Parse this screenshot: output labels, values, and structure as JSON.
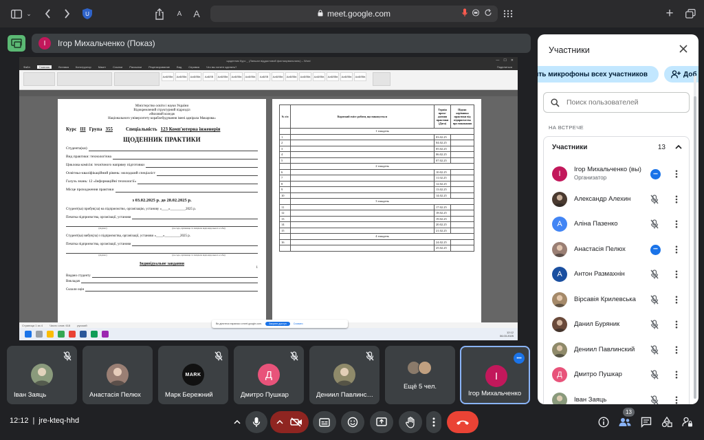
{
  "browser": {
    "url": "meet.google.com",
    "font_small": "A",
    "font_large": "A"
  },
  "presenter": {
    "initial": "І",
    "label": "Ігор Михальченко (Показ)"
  },
  "word": {
    "window_title": "щоденник Курс _ (Ланшал віддастовий фахтаарвальпаль) – Word",
    "tabs": [
      "Файл",
      "Главная",
      "Вставка",
      "Конструктор",
      "Макет",
      "Ссылки",
      "Рассылки",
      "Рецензирование",
      "Вид",
      "Справка",
      "Что вы хотите сделать?"
    ],
    "share": "Поделиться",
    "styles": [
      "АаБбВв",
      "АаБбВв",
      "АаБбВв",
      "АаБбВ",
      "АаБбВв",
      "АаБбВв",
      "АаБбВв",
      "АаБбВ",
      "АаБбВв",
      "АаБбВв",
      "АаБбВв",
      "АаБбВв",
      "АаБбВв",
      "АаБбВв",
      "АаБбВв"
    ],
    "status": [
      "Страница 1 из 4",
      "Число слов: 618",
      "русский"
    ],
    "left_page": {
      "header": [
        "Міністерство освіти і науки України",
        "Відокремлений структурний підрозділ",
        "«Фаховий коледж",
        "Національного університету кораблебудування імені адмірала Макарова»"
      ],
      "kurs_label": "Курс",
      "kurs": "ІІІ",
      "grupa_label": "Група",
      "grupa": "355",
      "spec_label": "Спеціальність",
      "spec": "123 Комп'ютерна інженерія",
      "title": "ЩОДЕННИК ПРАКТИКИ",
      "lines": [
        "Студента(ки)",
        "Вид практики: технологічна",
        "Циклова комісія: технічного напряму підготовки",
        "Освітньо-кваліфікаційний рівень: молодший спеціаліст",
        "Галузь знань: 12 «Інформаційні технології»",
        "Місце проходження практики"
      ],
      "dates": "з 03.02.2025 р. до 28.02.2025 р.",
      "arrived": "Студент(ка) прибув(ла) на підприємство, організацію, установу  «____»_________2025 р.",
      "stamp": "Печатка підприємства, організації, установи",
      "hint_sign": "(підпис)",
      "hint_full": "(посада, прізвище та ініціали відповідальної особи)",
      "left": "Студент(ка) вибув(ла) з підприємства, організації, установи  «____»_________2025 р.",
      "stamp2": "Печатка підприємства, організації, установи",
      "individual": "Індивідуальне завдання",
      "issued": "Видано студенту",
      "teacher": "Викладач",
      "exam": "Склали оцін",
      "page_num": "1"
    },
    "table": {
      "headers": [
        "№ з/п",
        "Короткий зміст роботи, що виконується",
        "Термін прохо-дження практики (Дата)",
        "Підпис керівника практики від підприємства про виконання"
      ],
      "weeks": [
        "1 тиждень",
        "2 тиждень",
        "3 тиждень",
        "4 тиждень"
      ],
      "rows": [
        {
          "n": "1",
          "d": "03.02.25"
        },
        {
          "n": "2",
          "d": "04.02.25"
        },
        {
          "n": "3",
          "d": "05.02.25"
        },
        {
          "n": "4",
          "d": "06.02.25"
        },
        {
          "n": "5",
          "d": "07.02.25"
        },
        {
          "n": "6",
          "d": "10.02.25"
        },
        {
          "n": "7",
          "d": "11.02.25"
        },
        {
          "n": "8",
          "d": "12.02.25"
        },
        {
          "n": "9",
          "d": "13.02.25"
        },
        {
          "n": "10",
          "d": "14.02.25"
        },
        {
          "n": "11",
          "d": "17.02.25"
        },
        {
          "n": "12",
          "d": "18.02.25"
        },
        {
          "n": "13",
          "d": "19.02.25"
        },
        {
          "n": "14",
          "d": "20.02.25"
        },
        {
          "n": "15",
          "d": "21.02.25"
        },
        {
          "n": "16",
          "d": "24.02.25"
        },
        {
          "n": "",
          "d": "25.02.25"
        }
      ]
    },
    "share_notice": {
      "text": "Ви ділитеся екраном з meet.google.com.",
      "stop": "Закрити доступ",
      "hide": "Сховати"
    },
    "taskbar_time": "12:12",
    "taskbar_date": "06.03.2025"
  },
  "tiles": [
    {
      "name": "Іван Заяць",
      "muted": true,
      "kind": "photo",
      "color": "#8a9a7c"
    },
    {
      "name": "Анастасія Пелюх",
      "muted": false,
      "kind": "photo",
      "color": "#9a7f74"
    },
    {
      "name": "Марк Бережний",
      "muted": true,
      "kind": "logo",
      "logo": "MARK"
    },
    {
      "name": "Дмитро Пушкар",
      "muted": true,
      "kind": "letter",
      "initial": "Д",
      "color": "#e8537a"
    },
    {
      "name": "Дениил Павлинский",
      "muted": true,
      "kind": "photo",
      "color": "#8f8a6a"
    },
    {
      "name": "Ещё 5 чел.",
      "muted": false,
      "kind": "more"
    },
    {
      "name": "Ігор Михальченко",
      "muted": false,
      "kind": "letter",
      "initial": "І",
      "color": "#c2185b",
      "active": true
    }
  ],
  "bottom": {
    "time": "12:12",
    "separator": "|",
    "code": "jre-kteq-hhd",
    "people_count": "13"
  },
  "panel": {
    "title": "Участники",
    "mute_all": "Отключить микрофоны всех участников",
    "add": "Доб",
    "search_placeholder": "Поиск пользователей",
    "section": "НА ВСТРЕЧЕ",
    "group": "Участники",
    "count": "13",
    "participants": [
      {
        "name": "Ігор Михальченко (вы)",
        "role": "Организатор",
        "status": "dots",
        "initial": "І",
        "color": "#c2185b",
        "kind": "letter"
      },
      {
        "name": "Александр Алехин",
        "role": "",
        "status": "muted",
        "kind": "photo",
        "color": "#4a3a30"
      },
      {
        "name": "Аліна Пазенко",
        "role": "",
        "status": "muted",
        "initial": "А",
        "color": "#4285f4",
        "kind": "letter"
      },
      {
        "name": "Анастасія Пелюх",
        "role": "",
        "status": "dots",
        "kind": "photo",
        "color": "#9a7f74"
      },
      {
        "name": "Антон Размахнін",
        "role": "",
        "status": "muted",
        "initial": "А",
        "color": "#1a4fa0",
        "kind": "letter"
      },
      {
        "name": "Вірсавія Крилевська",
        "role": "",
        "status": "muted",
        "kind": "photo",
        "color": "#a58a6a"
      },
      {
        "name": "Данил Буряник",
        "role": "",
        "status": "muted",
        "kind": "photo",
        "color": "#6a4a3a"
      },
      {
        "name": "Дениил Павлинский",
        "role": "",
        "status": "muted",
        "kind": "photo",
        "color": "#8f8a6a"
      },
      {
        "name": "Дмитро Пушкар",
        "role": "",
        "status": "muted",
        "initial": "Д",
        "color": "#e8537a",
        "kind": "letter"
      },
      {
        "name": "Іван Заяць",
        "role": "",
        "status": "muted",
        "kind": "photo",
        "color": "#8a9a7c"
      }
    ]
  }
}
